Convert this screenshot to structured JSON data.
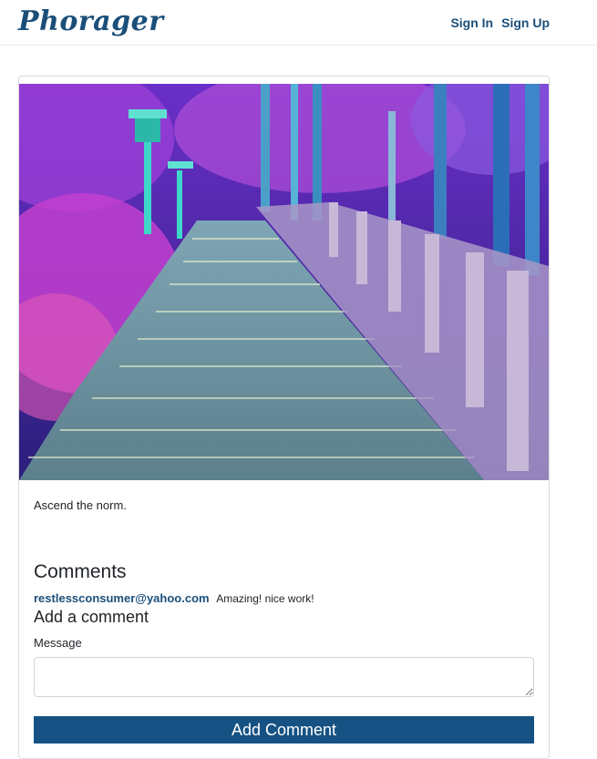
{
  "nav": {
    "brand": "Phorager",
    "sign_in": "Sign In",
    "sign_up": "Sign Up"
  },
  "post": {
    "image_alt": "Stone stairway through purple forest",
    "caption": "Ascend the norm."
  },
  "comments": {
    "heading": "Comments",
    "items": [
      {
        "author": "restlessconsumer@yahoo.com",
        "text": "Amazing! nice work!"
      }
    ]
  },
  "add_comment": {
    "heading": "Add a comment",
    "label": "Message",
    "value": "",
    "button_label": "Add Comment"
  },
  "colors": {
    "brand": "#1b4f7a",
    "button": "#155283"
  }
}
